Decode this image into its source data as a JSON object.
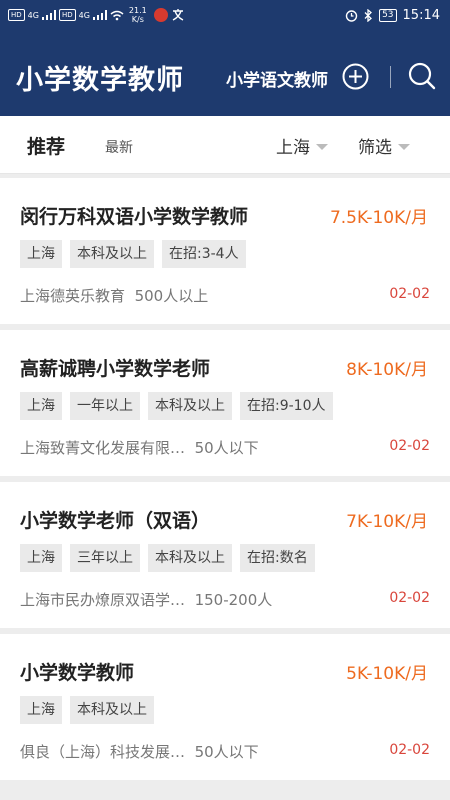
{
  "status_bar": {
    "sim1": "HD",
    "sim2": "HD",
    "net1": "4G",
    "net2": "4G",
    "speed_value": "21.1",
    "speed_unit": "K/s",
    "battery": "53",
    "time": "15:14"
  },
  "header": {
    "title": "小学数学教师",
    "subtitle": "小学语文教师"
  },
  "filter_bar": {
    "tab_recommend": "推荐",
    "tab_latest": "最新",
    "city": "上海",
    "filter": "筛选"
  },
  "jobs": [
    {
      "title": "闵行万科双语小学数学教师",
      "salary": "7.5K-10K/月",
      "tags": [
        "上海",
        "本科及以上",
        "在招:3-4人"
      ],
      "company": "上海德英乐教育",
      "size": "500人以上",
      "date": "02-02"
    },
    {
      "title": "高薪诚聘小学数学老师",
      "salary": "8K-10K/月",
      "tags": [
        "上海",
        "一年以上",
        "本科及以上",
        "在招:9-10人"
      ],
      "company": "上海致菁文化发展有限…",
      "size": "50人以下",
      "date": "02-02"
    },
    {
      "title": "小学数学老师（双语）",
      "salary": "7K-10K/月",
      "tags": [
        "上海",
        "三年以上",
        "本科及以上",
        "在招:数名"
      ],
      "company": "上海市民办燎原双语学…",
      "size": "150-200人",
      "date": "02-02"
    },
    {
      "title": "小学数学教师",
      "salary": "5K-10K/月",
      "tags": [
        "上海",
        "本科及以上"
      ],
      "company": "俱良（上海）科技发展…",
      "size": "50人以下",
      "date": "02-02"
    }
  ]
}
